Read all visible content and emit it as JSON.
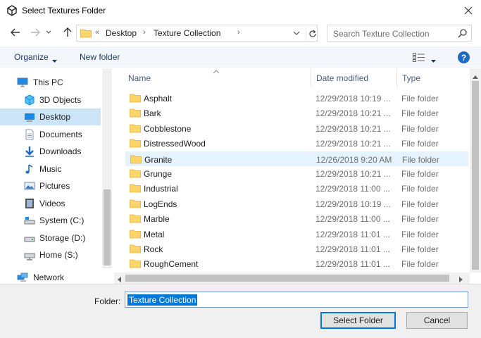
{
  "window": {
    "title": "Select Textures Folder"
  },
  "address": {
    "prefix": "«",
    "crumbs": [
      "Desktop",
      "Texture Collection"
    ]
  },
  "search": {
    "placeholder": "Search Texture Collection"
  },
  "toolbar": {
    "organize_label": "Organize",
    "new_folder_label": "New folder",
    "help_label": "?"
  },
  "nav": {
    "items": [
      {
        "label": "This PC",
        "icon": "pc-icon"
      },
      {
        "label": "3D Objects",
        "icon": "3d-objects-icon"
      },
      {
        "label": "Desktop",
        "icon": "desktop-icon"
      },
      {
        "label": "Documents",
        "icon": "documents-icon"
      },
      {
        "label": "Downloads",
        "icon": "downloads-icon"
      },
      {
        "label": "Music",
        "icon": "music-icon"
      },
      {
        "label": "Pictures",
        "icon": "pictures-icon"
      },
      {
        "label": "Videos",
        "icon": "videos-icon"
      },
      {
        "label": "System (C:)",
        "icon": "drive-icon"
      },
      {
        "label": "Storage (D:)",
        "icon": "drive-icon"
      },
      {
        "label": "Home (S:)",
        "icon": "network-drive-icon"
      },
      {
        "label": "Network",
        "icon": "network-icon"
      }
    ],
    "selected": "Desktop"
  },
  "columns": {
    "name": "Name",
    "date": "Date modified",
    "type": "Type"
  },
  "files": [
    {
      "name": "Asphalt",
      "date": "12/29/2018 10:19 ...",
      "type": "File folder"
    },
    {
      "name": "Bark",
      "date": "12/29/2018 10:21 ...",
      "type": "File folder"
    },
    {
      "name": "Cobblestone",
      "date": "12/29/2018 10:21 ...",
      "type": "File folder"
    },
    {
      "name": "DistressedWood",
      "date": "12/29/2018 10:21 ...",
      "type": "File folder"
    },
    {
      "name": "Granite",
      "date": "12/26/2018 9:20 AM",
      "type": "File folder"
    },
    {
      "name": "Grunge",
      "date": "12/29/2018 10:21 ...",
      "type": "File folder"
    },
    {
      "name": "Industrial",
      "date": "12/29/2018 11:00 ...",
      "type": "File folder"
    },
    {
      "name": "LogEnds",
      "date": "12/29/2018 10:19 ...",
      "type": "File folder"
    },
    {
      "name": "Marble",
      "date": "12/29/2018 11:00 ...",
      "type": "File folder"
    },
    {
      "name": "Metal",
      "date": "12/29/2018 11:01 ...",
      "type": "File folder"
    },
    {
      "name": "Rock",
      "date": "12/29/2018 11:01 ...",
      "type": "File folder"
    },
    {
      "name": "RoughCement",
      "date": "12/29/2018 11:01 ...",
      "type": "File folder"
    }
  ],
  "hovered_file": "Granite",
  "footer": {
    "folder_label": "Folder:",
    "folder_value": "Texture Collection",
    "select_button": "Select Folder",
    "cancel_button": "Cancel"
  },
  "colors": {
    "accent": "#0078d7",
    "selection": "#cce4f7",
    "hover": "#e5f3ff",
    "folder": "#ffd469"
  }
}
